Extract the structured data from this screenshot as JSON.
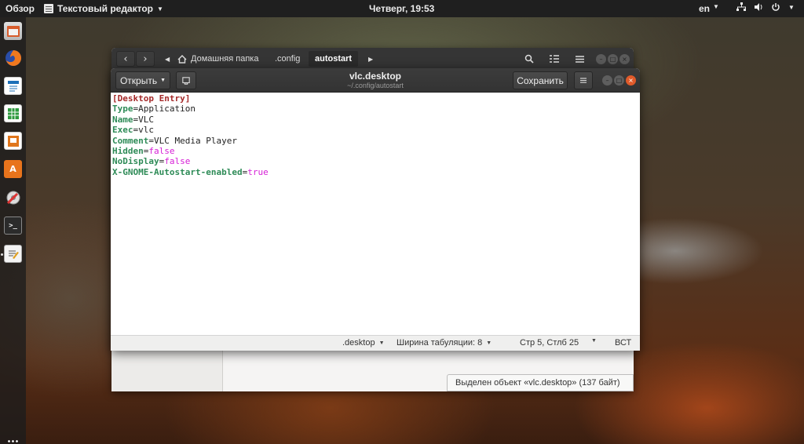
{
  "topbar": {
    "activities": "Обзор",
    "app_menu": "Текстовый редактор",
    "clock": "Четверг, 19:53",
    "language": "en"
  },
  "dock": {
    "items": [
      "files-icon",
      "firefox-icon",
      "writer-icon",
      "calc-icon",
      "impress-icon",
      "software-center-icon",
      "settings-icon",
      "terminal-icon",
      "text-editor-icon"
    ]
  },
  "file_manager": {
    "breadcrumbs": [
      "Домашняя папка",
      ".config",
      "autostart"
    ],
    "status": "Выделен объект «vlc.desktop» (137 байт)"
  },
  "gedit": {
    "open_label": "Открыть",
    "save_label": "Сохранить",
    "title": "vlc.desktop",
    "subtitle": "~/.config/autostart",
    "lines": [
      {
        "key": "[Desktop Entry]"
      },
      {
        "key": "Type",
        "value": "Application"
      },
      {
        "key": "Name",
        "value": "VLC"
      },
      {
        "key": "Exec",
        "value": "vlc"
      },
      {
        "key": "Comment",
        "value": "VLC Media Player"
      },
      {
        "key": "Hidden",
        "value": "false"
      },
      {
        "key": "NoDisplay",
        "value": "false"
      },
      {
        "key": "X-GNOME-Autostart-enabled",
        "value": "true"
      }
    ],
    "status": {
      "language": ".desktop",
      "tab_width": "Ширина табуляции: 8",
      "position": "Стр 5, Стлб 25",
      "insert_mode": "ВСТ"
    }
  }
}
